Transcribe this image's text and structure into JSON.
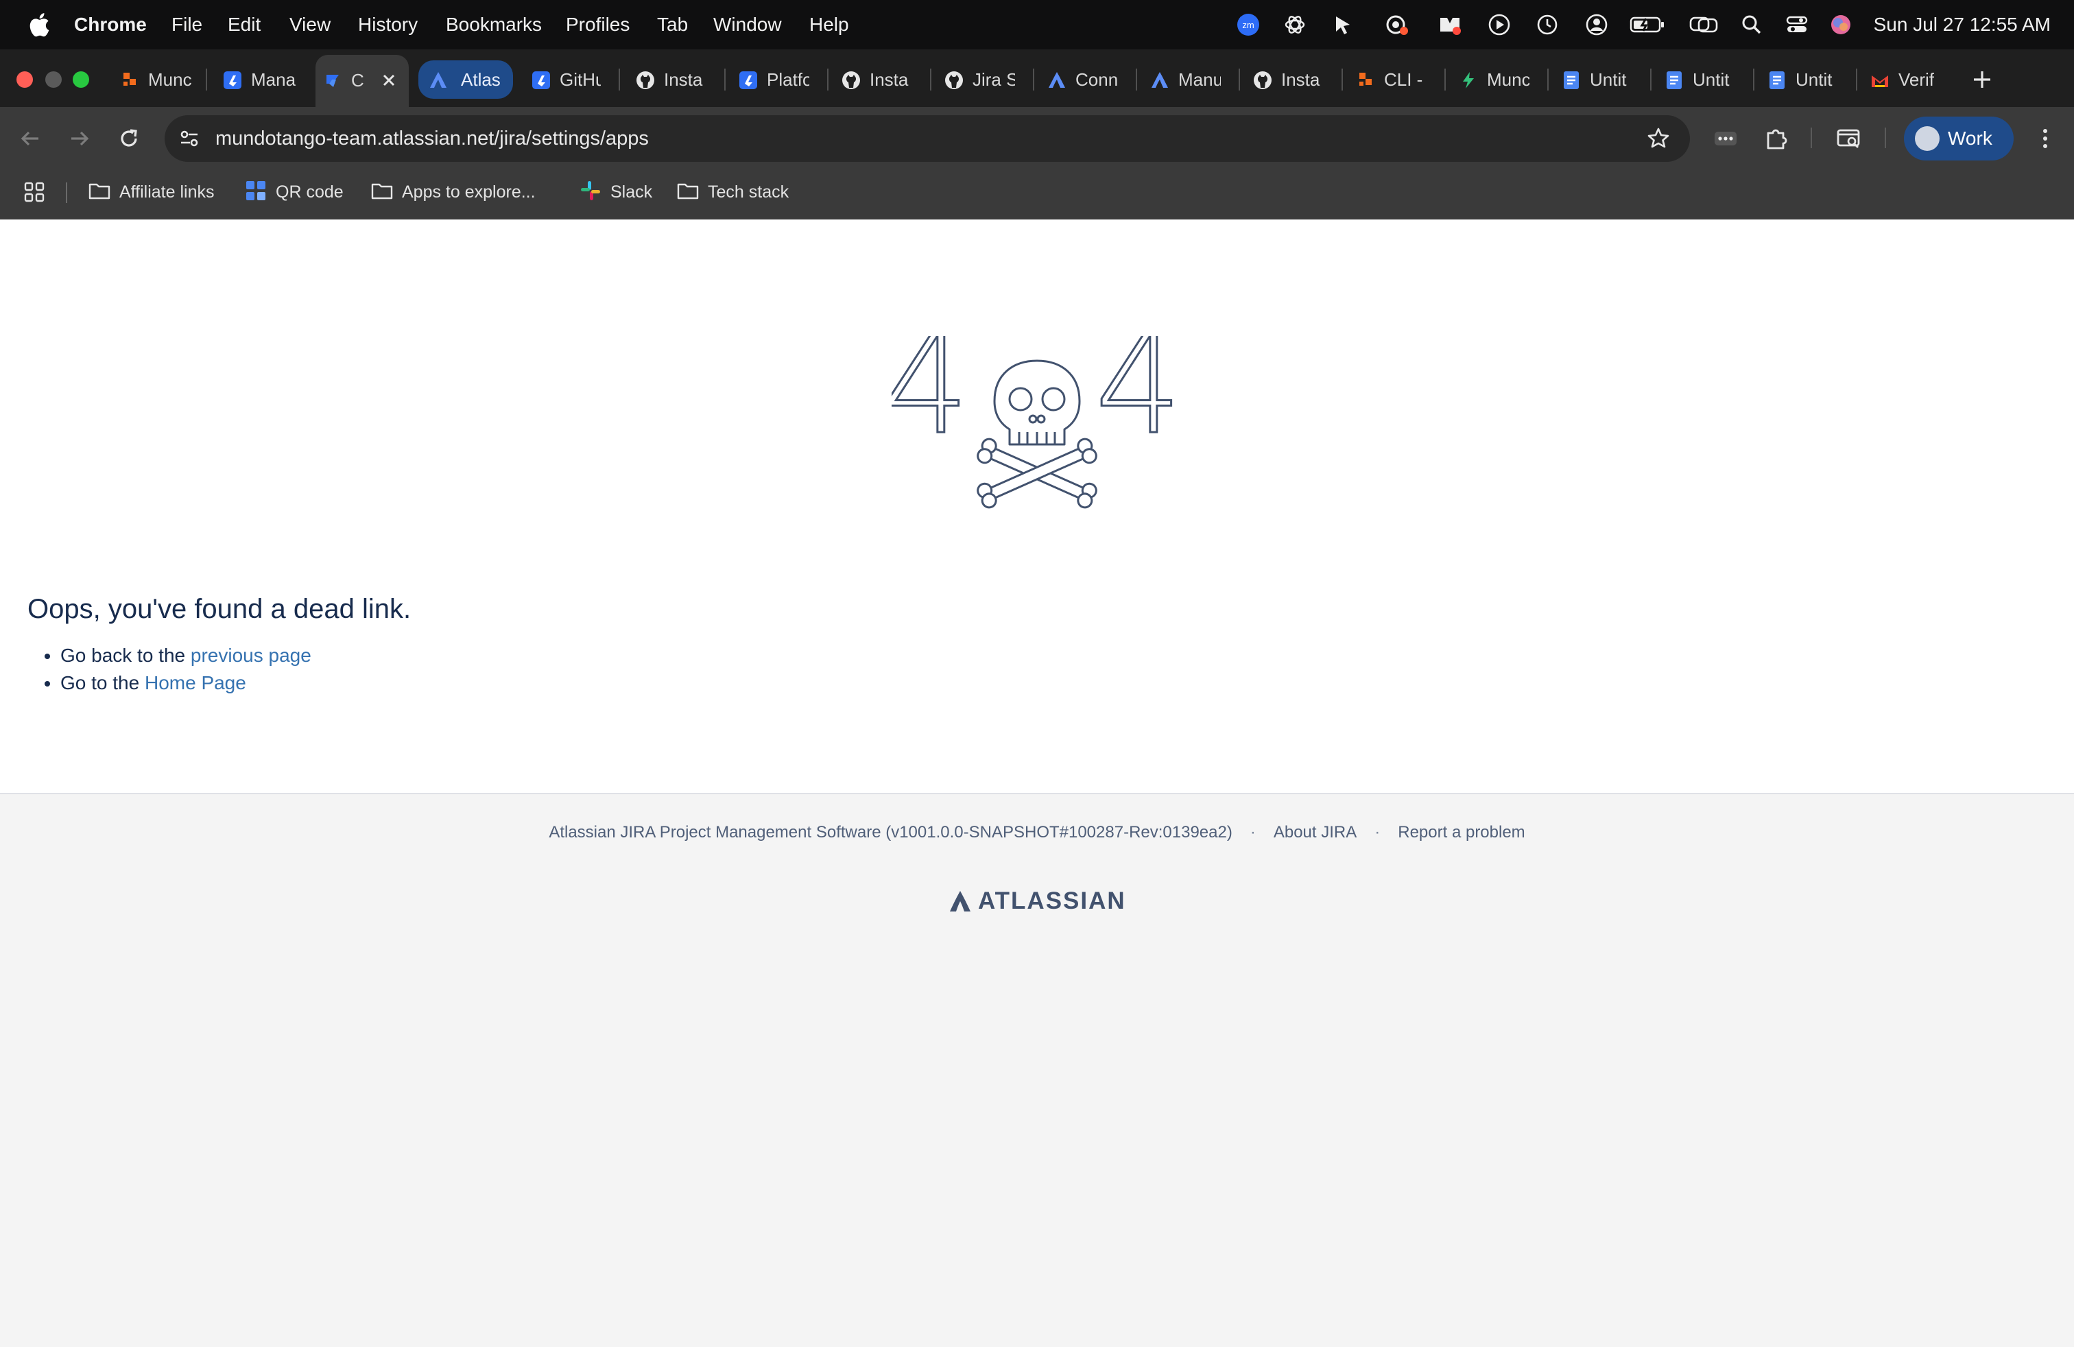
{
  "menubar": {
    "app_name": "Chrome",
    "items": [
      "File",
      "Edit",
      "View",
      "History",
      "Bookmarks",
      "Profiles",
      "Tab",
      "Window",
      "Help"
    ],
    "status_icons": [
      "zoom-icon",
      "openai-icon",
      "cursor-icon",
      "record-icon",
      "mail-icon",
      "play-icon",
      "time-machine-icon",
      "user-icon",
      "battery-icon",
      "screen-mirror-icon",
      "spotlight-search-icon",
      "control-center-icon",
      "siri-icon"
    ],
    "clock": "Sun Jul 27  12:55 AM"
  },
  "tabs": [
    {
      "label": "Munc",
      "icon": "mundo-icon",
      "state": "normal"
    },
    {
      "label": "Mana",
      "icon": "jira-icon",
      "state": "normal"
    },
    {
      "label": "C",
      "icon": "jira-icon",
      "state": "active"
    },
    {
      "label": "Atlas",
      "icon": "atlassian-icon",
      "state": "highlight"
    },
    {
      "label": "GitHu",
      "icon": "jira-icon",
      "state": "normal"
    },
    {
      "label": "Insta",
      "icon": "github-icon",
      "state": "normal"
    },
    {
      "label": "Platfo",
      "icon": "jira-icon",
      "state": "normal"
    },
    {
      "label": "Insta",
      "icon": "github-icon",
      "state": "normal"
    },
    {
      "label": "Jira S",
      "icon": "github-icon",
      "state": "normal"
    },
    {
      "label": "Conn",
      "icon": "atlassian-icon",
      "state": "normal"
    },
    {
      "label": "Manu",
      "icon": "atlassian-icon",
      "state": "normal"
    },
    {
      "label": "Insta",
      "icon": "github-icon",
      "state": "normal"
    },
    {
      "label": "CLI -",
      "icon": "mundo-icon",
      "state": "normal"
    },
    {
      "label": "Munc",
      "icon": "bolt-icon",
      "state": "normal"
    },
    {
      "label": "Untit",
      "icon": "docs-icon",
      "state": "normal"
    },
    {
      "label": "Untit",
      "icon": "docs-icon",
      "state": "normal"
    },
    {
      "label": "Untit",
      "icon": "docs-icon",
      "state": "normal"
    },
    {
      "label": "Verif",
      "icon": "gmail-icon",
      "state": "normal"
    }
  ],
  "toolbar": {
    "url": "mundotango-team.atlassian.net/jira/settings/apps",
    "profile_label": "Work"
  },
  "bookmarks": [
    {
      "label": "Affiliate links",
      "icon": "folder-icon"
    },
    {
      "label": "QR code",
      "icon": "qr-app-icon"
    },
    {
      "label": "Apps to explore...",
      "icon": "folder-icon"
    },
    {
      "label": "Slack",
      "icon": "slack-icon"
    },
    {
      "label": "Tech stack",
      "icon": "folder-icon"
    }
  ],
  "page": {
    "illustration_text": [
      "4",
      "4"
    ],
    "heading": "Oops, you've found a dead link.",
    "items": [
      {
        "prefix": "Go back to the ",
        "link": "previous page"
      },
      {
        "prefix": "Go to the ",
        "link": "Home Page"
      }
    ]
  },
  "footer": {
    "version_text": "Atlassian JIRA Project Management Software (v1001.0.0-SNAPSHOT#100287-Rev:0139ea2)",
    "dot": "·",
    "about": "About JIRA",
    "report": "Report a problem",
    "logo_text": "ATLASSIAN"
  },
  "colors": {
    "link": "#3572b0",
    "text": "#172b4d",
    "chrome_dark": "#1f1f1f",
    "chrome_toolbar": "#3a3a3a",
    "highlight_tab": "#1f4b8a"
  }
}
